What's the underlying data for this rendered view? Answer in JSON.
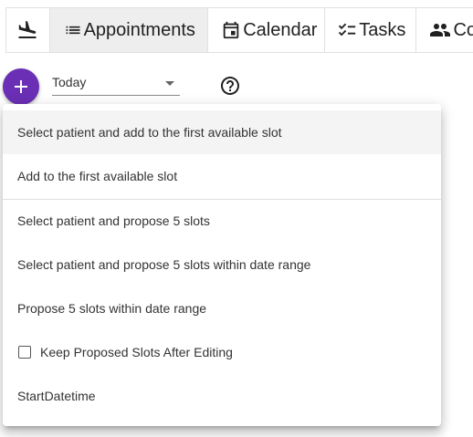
{
  "tabs": [
    {
      "label": "",
      "icon": "flight-land-icon"
    },
    {
      "label": "Appointments",
      "icon": "list-icon",
      "active": true
    },
    {
      "label": "Calendar",
      "icon": "calendar-icon"
    },
    {
      "label": "Tasks",
      "icon": "checklist-icon"
    },
    {
      "label": "Co",
      "icon": "people-icon"
    }
  ],
  "toolbar": {
    "add_icon": "plus-icon",
    "date_filter_value": "Today",
    "help_icon": "help-circle-icon"
  },
  "menu": {
    "items": [
      "Select patient and add to the first available slot",
      "Add to the first available slot",
      "Select patient and propose 5 slots",
      "Select patient and propose 5 slots within date range",
      "Propose 5 slots within date range",
      "Keep Proposed Slots After Editing",
      "StartDatetime"
    ],
    "keep_proposed_checked": false
  },
  "colors": {
    "fab": "#6a2fb4",
    "active_tab_bg": "#eeeeee",
    "highlight_item_bg": "#f4f4f4"
  }
}
